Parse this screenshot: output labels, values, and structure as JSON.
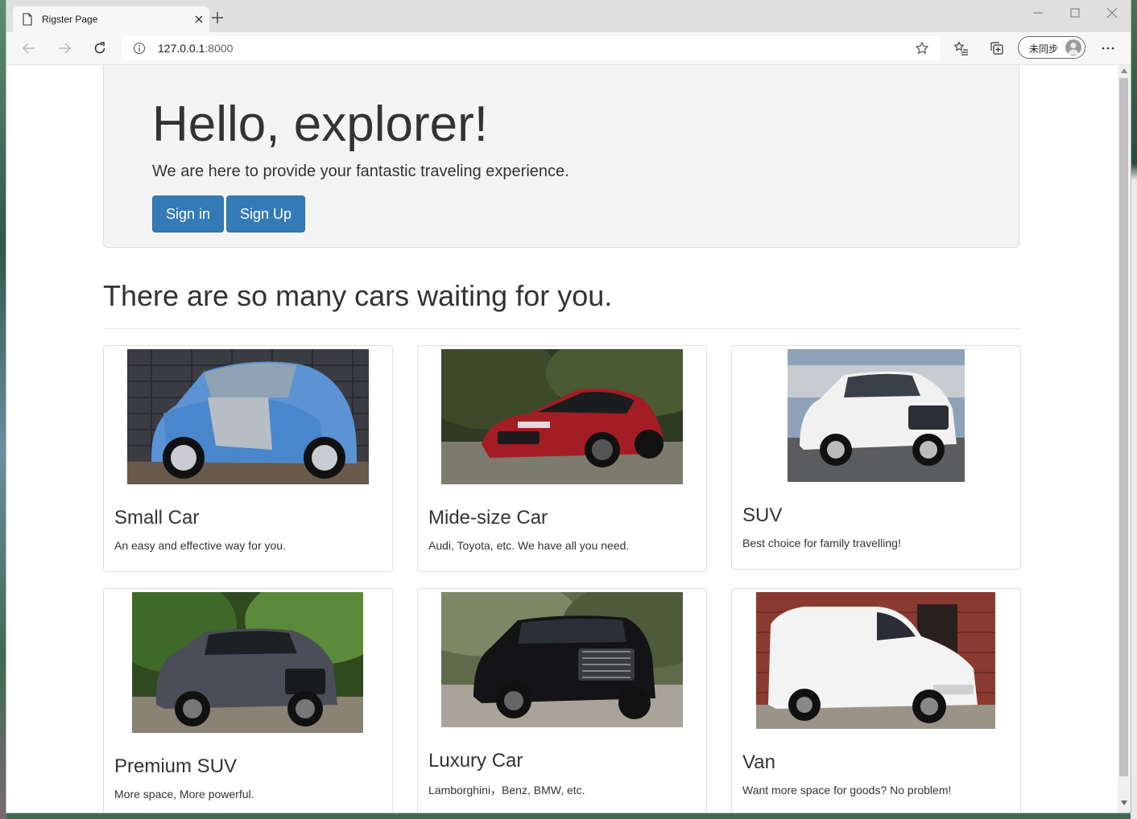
{
  "browser": {
    "tab_title": "Rigster Page",
    "url_host": "127.0.0.1",
    "url_port": ":8000",
    "profile_label": "未同步"
  },
  "hero": {
    "heading": "Hello, explorer!",
    "tagline": "We are here to provide your fantastic traveling experience.",
    "signin_label": "Sign in",
    "signup_label": "Sign Up"
  },
  "section": {
    "title": "There are so many cars waiting for you."
  },
  "cars": [
    {
      "name": "Small Car",
      "desc": "An easy and effective way for you."
    },
    {
      "name": "Mide-size Car",
      "desc": "Audi, Toyota, etc. We have all you need."
    },
    {
      "name": "SUV",
      "desc": "Best choice for family travelling!"
    },
    {
      "name": "Premium SUV",
      "desc": "More space, More powerful."
    },
    {
      "name": "Luxury Car",
      "desc": "Lamborghini，Benz, BMW, etc."
    },
    {
      "name": "Van",
      "desc": "Want more space for goods? No problem!"
    }
  ],
  "colors": {
    "primary_button": "#337ab7",
    "jumbotron_bg": "#f4f4f4"
  }
}
